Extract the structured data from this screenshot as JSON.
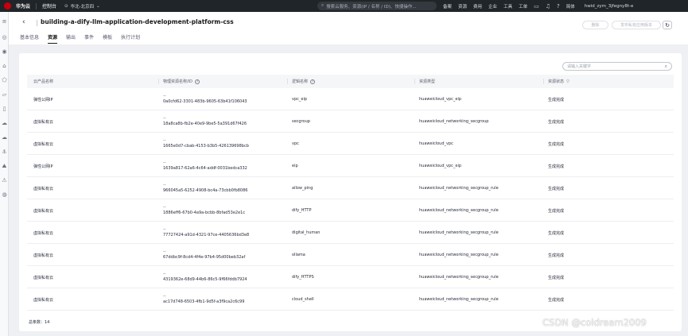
{
  "topbar": {
    "brand": "华为云",
    "console": "控制台",
    "region": "华北-北京四",
    "search_placeholder": "搜索云服务、资源(IP / 名称 / ID)、快捷操作...",
    "menu": [
      "备案",
      "资源",
      "费用",
      "企业",
      "工具",
      "工单"
    ],
    "language": "简体",
    "user": "hwid_zym_3jfegny8t-e"
  },
  "header": {
    "title": "building-a-dify-llm-application-development-platform-css",
    "delete_label": "删除",
    "publish_label": "发布私有应用版本",
    "tabs": [
      "基本信息",
      "资源",
      "输出",
      "事件",
      "模板",
      "执行计划"
    ],
    "active_tab": 1
  },
  "table": {
    "filter_placeholder": "请输入关键字",
    "columns": [
      "云产品名称",
      "物理资源名称/ID",
      "逻辑名称",
      "资源类型",
      "资源状态"
    ],
    "rows": [
      {
        "product": "弹性公网IP",
        "dash": "--",
        "physical_id": "0a0cfd62-3301-483b-9605-63b41f106043",
        "logical": "vpc_eip",
        "type": "huaweicloud_vpc_eip",
        "status": "生成完成"
      },
      {
        "product": "虚拟私有云",
        "dash": "--",
        "physical_id": "18a8ca8b-fb2e-40e9-9be5-5a391d67f426",
        "logical": "secgroup",
        "type": "huaweicloud_networking_secgroup",
        "status": "生成完成"
      },
      {
        "product": "虚拟私有云",
        "dash": "--",
        "physical_id": "1665e0d7-cbab-4153-b3b5-426139698bcb",
        "logical": "vpc",
        "type": "huaweicloud_vpc",
        "status": "生成完成"
      },
      {
        "product": "弹性公网IP",
        "dash": "--",
        "physical_id": "1639a817-62a6-4c64-addf-0031bedca332",
        "logical": "eip",
        "type": "huaweicloud_vpc_eip",
        "status": "生成完成"
      },
      {
        "product": "虚拟私有云",
        "dash": "--",
        "physical_id": "966045a5-6252-4908-bc4a-73cbb0fb8086",
        "logical": "allow_ping",
        "type": "huaweicloud_networking_secgroup_rule",
        "status": "生成完成"
      },
      {
        "product": "虚拟私有云",
        "dash": "--",
        "physical_id": "1886eff6-67b0-4a9a-bcbb-8bfad53e2e1c",
        "logical": "dify_HTTP",
        "type": "huaweicloud_networking_secgroup_rule",
        "status": "生成完成"
      },
      {
        "product": "虚拟私有云",
        "dash": "--",
        "physical_id": "77727424-a91d-4321-97ce-4405636bd3e8",
        "logical": "digital_human",
        "type": "huaweicloud_networking_secgroup_rule",
        "status": "生成完成"
      },
      {
        "product": "虚拟私有云",
        "dash": "--",
        "physical_id": "67ddbc9f-8cd4-4f4e-97b4-95d00beb32af",
        "logical": "ollama",
        "type": "huaweicloud_networking_secgroup_rule",
        "status": "生成完成"
      },
      {
        "product": "虚拟私有云",
        "dash": "--",
        "physical_id": "4319362e-68d9-44b6-86c5-9f66fddb7924",
        "logical": "dify_HTTPS",
        "type": "huaweicloud_networking_secgroup_rule",
        "status": "生成完成"
      },
      {
        "product": "虚拟私有云",
        "dash": "--",
        "physical_id": "ac17d748-6503-4fb1-9d5f-a3f9ca2c6c99",
        "logical": "cloud_shell",
        "type": "huaweicloud_networking_secgroup_rule",
        "status": "生成完成"
      }
    ],
    "total": "总条数：14"
  },
  "watermark": "CSDN @coldream2009",
  "colors": {
    "topbar": "#202529",
    "brand_red": "#c7000b",
    "page_bg": "#eef0f4"
  }
}
